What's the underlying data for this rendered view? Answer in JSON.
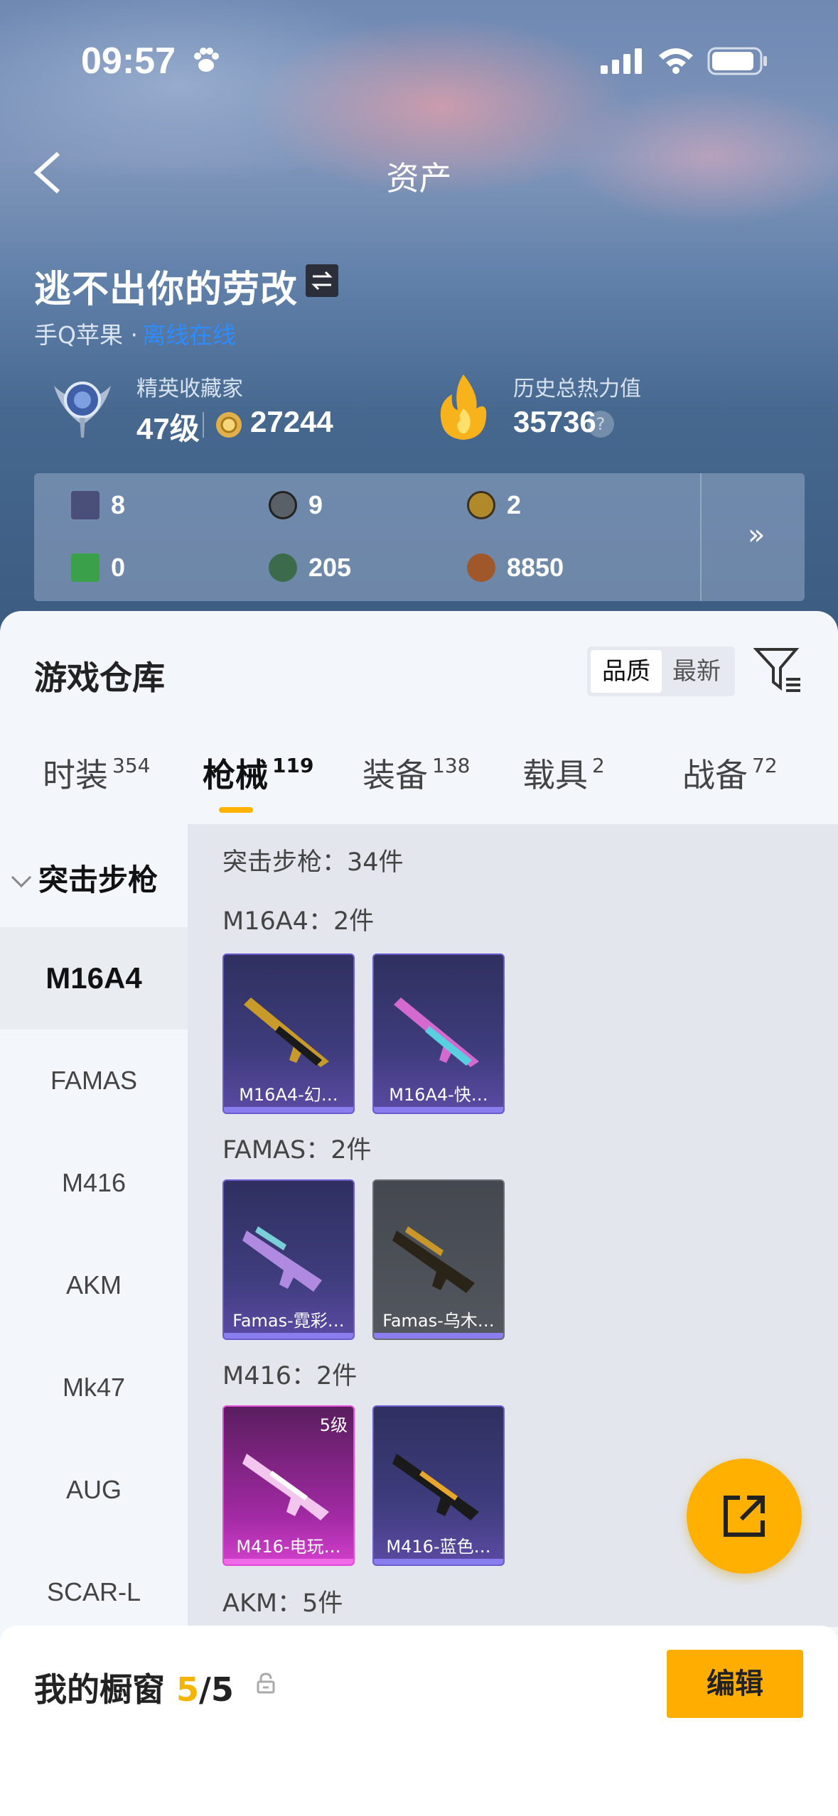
{
  "status_bar": {
    "time": "09:57"
  },
  "header": {
    "title": "资产"
  },
  "profile": {
    "nickname": "逃不出你的劳改",
    "platform": "手Q苹果 ·",
    "online_status": "离线在线",
    "badge_label": "精英收藏家",
    "level": "47级",
    "coins": "27244",
    "heat_label": "历史总热力值",
    "heat_value": "35736"
  },
  "resources": [
    {
      "icon": "card-icon",
      "value": "8",
      "color": "#4a4f7a"
    },
    {
      "icon": "silver-coin-icon",
      "value": "9",
      "color": "#5a6068"
    },
    {
      "icon": "gold-token-icon",
      "value": "2",
      "color": "#b08a2a"
    },
    {
      "icon": "green-ticket-icon",
      "value": "0",
      "color": "#3aa04a"
    },
    {
      "icon": "jade-orb-icon",
      "value": "205",
      "color": "#3b6b4a"
    },
    {
      "icon": "bronze-coin-icon",
      "value": "8850",
      "color": "#a0582a"
    }
  ],
  "warehouse": {
    "title": "游戏仓库",
    "sort_options": [
      "品质",
      "最新"
    ],
    "tabs": [
      {
        "label": "时装",
        "count": "354"
      },
      {
        "label": "枪械",
        "count": "119"
      },
      {
        "label": "装备",
        "count": "138"
      },
      {
        "label": "载具",
        "count": "2"
      },
      {
        "label": "战备",
        "count": "72"
      }
    ]
  },
  "sidebar": {
    "category": "突击步枪",
    "items": [
      "M16A4",
      "FAMAS",
      "M416",
      "AKM",
      "Mk47",
      "AUG",
      "SCAR-L"
    ]
  },
  "content": {
    "summary": "突击步枪：34件",
    "groups": [
      {
        "label": "M16A4：2件",
        "items": [
          {
            "name": "M16A4-幻…"
          },
          {
            "name": "M16A4-快…"
          }
        ]
      },
      {
        "label": "FAMAS：2件",
        "items": [
          {
            "name": "Famas-霓彩…"
          },
          {
            "name": "Famas-乌木…"
          }
        ]
      },
      {
        "label": "M416：2件",
        "items": [
          {
            "name": "M416-电玩…",
            "level": "5级"
          },
          {
            "name": "M416-蓝色…"
          }
        ]
      },
      {
        "label": "AKM：5件",
        "items": []
      }
    ]
  },
  "showcase": {
    "label": "我的橱窗",
    "current": "5",
    "total": "/5",
    "edit_label": "编辑"
  },
  "colors": {
    "accent": "#ffb000",
    "online": "#2d8cff"
  }
}
